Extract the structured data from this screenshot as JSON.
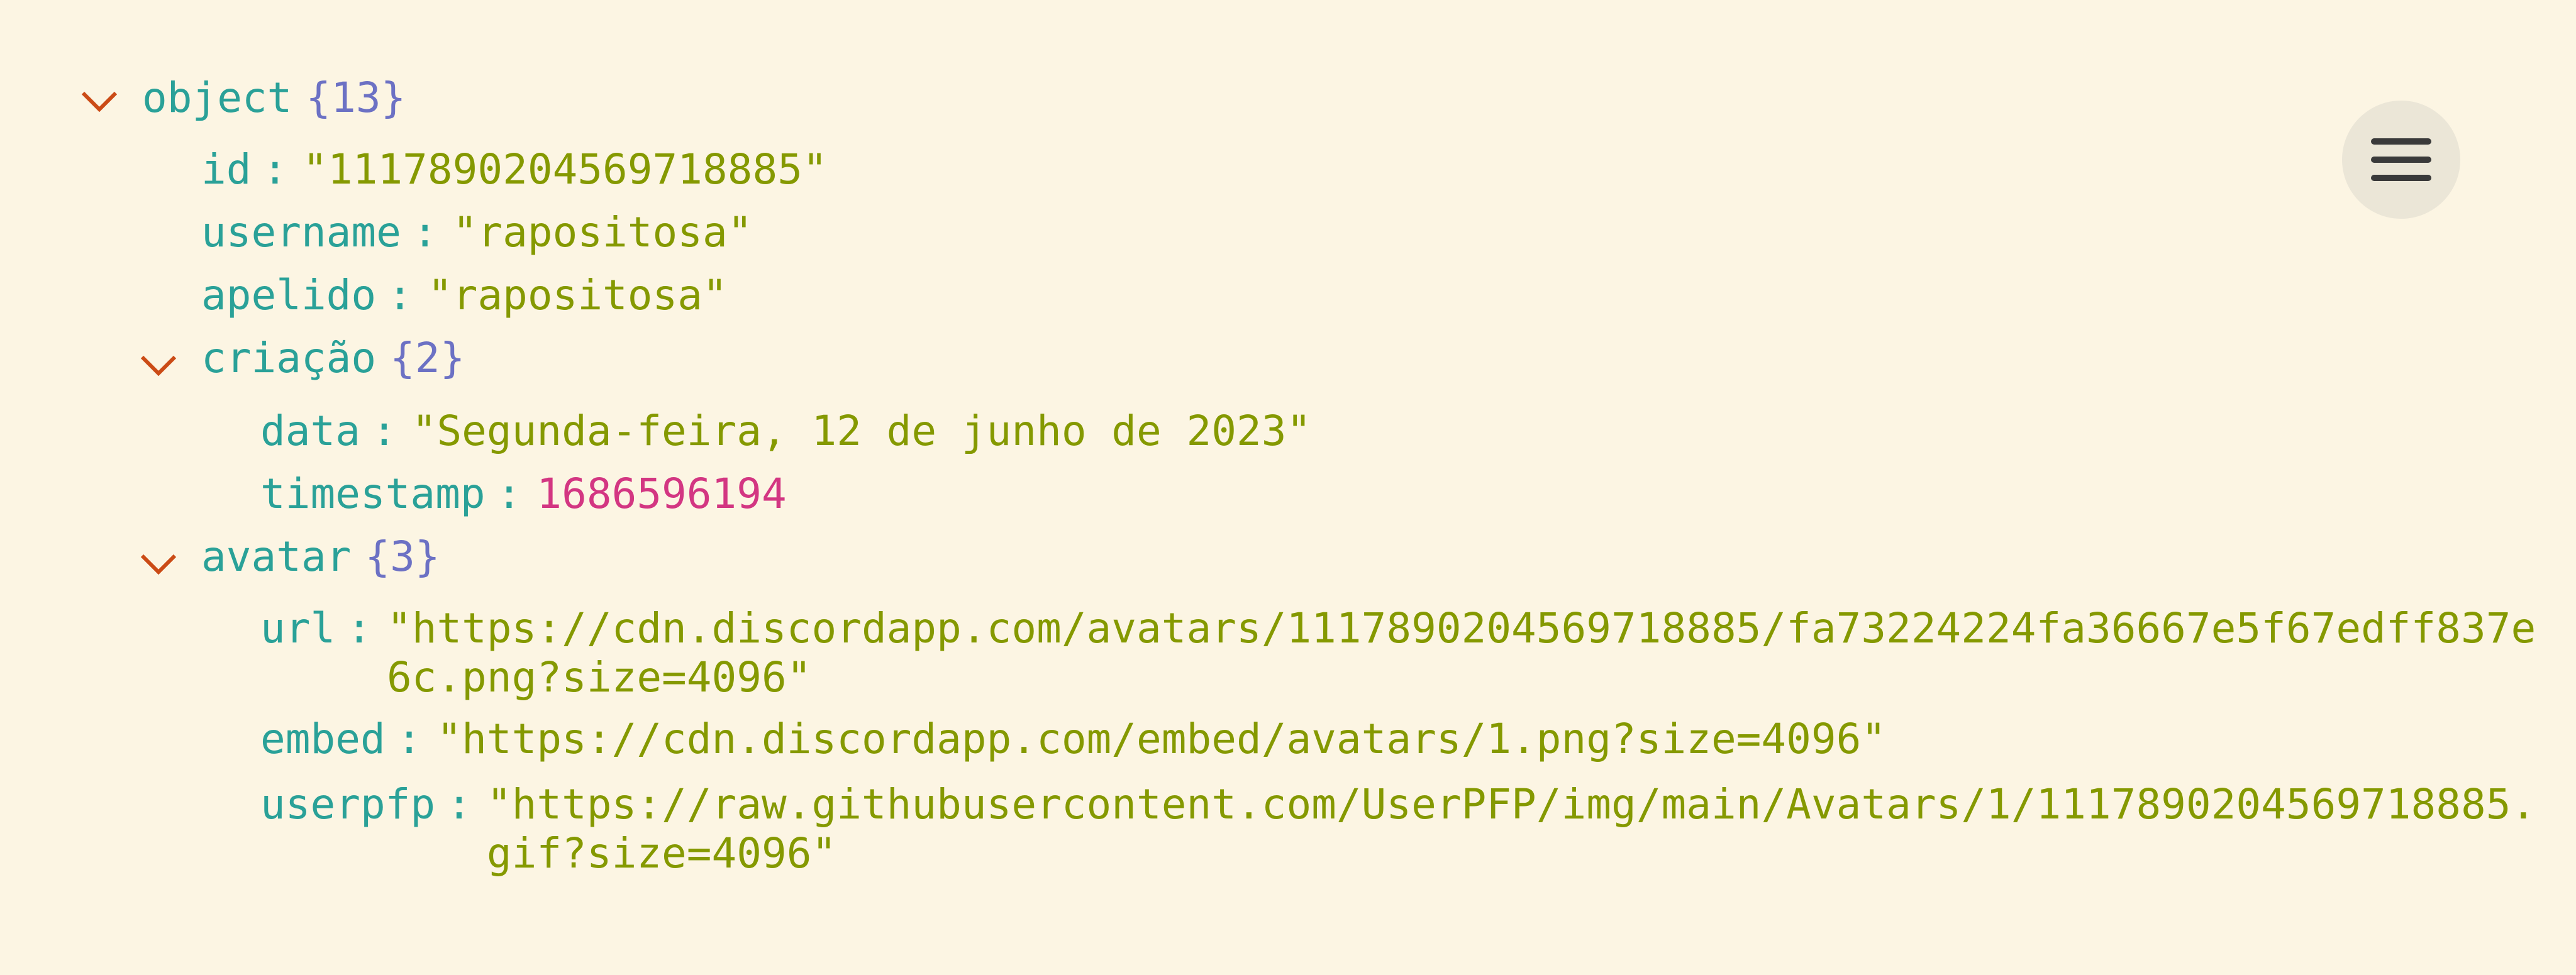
{
  "tree": {
    "root": {
      "key": "object",
      "count": "{13}"
    },
    "separator": ":",
    "fields": {
      "id": {
        "key": "id",
        "value": "\"1117890204569718885\""
      },
      "username": {
        "key": "username",
        "value": "\"rapositosa\""
      },
      "apelido": {
        "key": "apelido",
        "value": "\"rapositosa\""
      }
    },
    "criacao": {
      "key": "criação",
      "count": "{2}",
      "data": {
        "key": "data",
        "value": "\"Segunda-feira, 12 de junho de 2023\""
      },
      "timestamp": {
        "key": "timestamp",
        "value": "1686596194"
      }
    },
    "avatar": {
      "key": "avatar",
      "count": "{3}",
      "url": {
        "key": "url",
        "value": "\"https://cdn.discordapp.com/avatars/1117890204569718885/fa73224224fa36667e5f67edff837e6c.png?size=4096\""
      },
      "embed": {
        "key": "embed",
        "value": "\"https://cdn.discordapp.com/embed/avatars/1.png?size=4096\""
      },
      "userpfp": {
        "key": "userpfp",
        "value": "\"https://raw.githubusercontent.com/UserPFP/img/main/Avatars/1/1117890204569718885.gif?size=4096\""
      }
    }
  },
  "colors": {
    "background": "#fcf5e3",
    "key": "#2aa198",
    "string": "#859900",
    "number": "#d33682",
    "brace": "#6c71c4",
    "toggle": "#cb4b16"
  },
  "icons": {
    "toggle": "chevron-down-icon",
    "menu": "hamburger-menu-icon"
  }
}
